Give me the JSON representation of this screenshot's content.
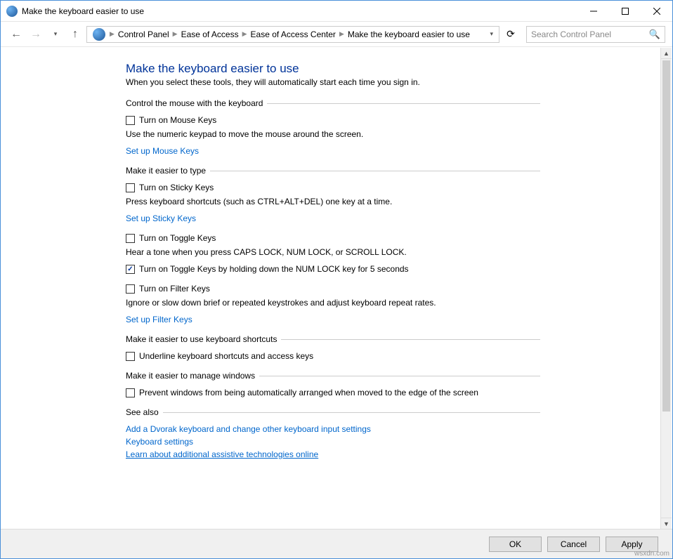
{
  "window": {
    "title": "Make the keyboard easier to use"
  },
  "breadcrumb": {
    "items": [
      "Control Panel",
      "Ease of Access",
      "Ease of Access Center",
      "Make the keyboard easier to use"
    ]
  },
  "search": {
    "placeholder": "Search Control Panel"
  },
  "page": {
    "title": "Make the keyboard easier to use",
    "subtitle": "When you select these tools, they will automatically start each time you sign in."
  },
  "sections": {
    "mouse": {
      "heading": "Control the mouse with the keyboard",
      "opt1_label": "Turn on Mouse Keys",
      "opt1_desc": "Use the numeric keypad to move the mouse around the screen.",
      "link": "Set up Mouse Keys"
    },
    "type": {
      "heading": "Make it easier to type",
      "sticky_label": "Turn on Sticky Keys",
      "sticky_desc": "Press keyboard shortcuts (such as CTRL+ALT+DEL) one key at a time.",
      "sticky_link": "Set up Sticky Keys",
      "toggle_label": "Turn on Toggle Keys",
      "toggle_desc": "Hear a tone when you press CAPS LOCK, NUM LOCK, or SCROLL LOCK.",
      "toggle_sub_label": "Turn on Toggle Keys by holding down the NUM LOCK key for 5 seconds",
      "filter_label": "Turn on Filter Keys",
      "filter_desc": "Ignore or slow down brief or repeated keystrokes and adjust keyboard repeat rates.",
      "filter_link": "Set up Filter Keys"
    },
    "shortcuts": {
      "heading": "Make it easier to use keyboard shortcuts",
      "opt_label": "Underline keyboard shortcuts and access keys"
    },
    "windows": {
      "heading": "Make it easier to manage windows",
      "opt_label": "Prevent windows from being automatically arranged when moved to the edge of the screen"
    },
    "seealso": {
      "heading": "See also",
      "link1": "Add a Dvorak keyboard and change other keyboard input settings",
      "link2": "Keyboard settings",
      "link3": "Learn about additional assistive technologies online"
    }
  },
  "buttons": {
    "ok": "OK",
    "cancel": "Cancel",
    "apply": "Apply"
  },
  "watermark": "wsxdn.com"
}
